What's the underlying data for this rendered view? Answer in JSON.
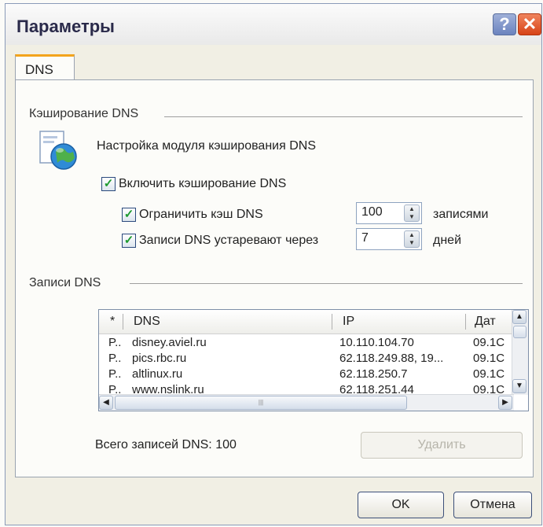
{
  "window": {
    "title": "Параметры",
    "help_glyph": "?",
    "close_glyph": "✕"
  },
  "tab": {
    "label": "DNS"
  },
  "caching": {
    "group_label": "Кэширование DNS",
    "description": "Настройка модуля кэширования DNS",
    "enable_label": "Включить кэширование DNS",
    "limit_label": "Ограничить кэш DNS",
    "limit_value": "100",
    "limit_unit": "записями",
    "expire_label": "Записи DNS устаревают через",
    "expire_value": "7",
    "expire_unit": "дней",
    "enable_checked": true,
    "limit_checked": true,
    "expire_checked": true,
    "check_glyph": "✓"
  },
  "records": {
    "group_label": "Записи DNS",
    "columns": {
      "sort": "*",
      "dns": "DNS",
      "ip": "IP",
      "date": "Дат"
    },
    "rows": [
      {
        "type": "P..",
        "dns": "disney.aviel.ru",
        "ip": "10.110.104.70",
        "date": "09.1C"
      },
      {
        "type": "P..",
        "dns": "pics.rbc.ru",
        "ip": "62.118.249.88, 19...",
        "date": "09.1C"
      },
      {
        "type": "P..",
        "dns": "altlinux.ru",
        "ip": "62.118.250.7",
        "date": "09.1C"
      },
      {
        "type": "P..",
        "dns": "www.nslink.ru",
        "ip": "62.118.251.44",
        "date": "09.1C"
      }
    ],
    "total_label": "Всего записей DNS: 100",
    "delete_label": "Удалить"
  },
  "buttons": {
    "ok": "OK",
    "cancel": "Отмена"
  },
  "colors": {
    "tab_accent": "#f3a41c",
    "close": "#d74317",
    "check": "#1e9a2f"
  }
}
